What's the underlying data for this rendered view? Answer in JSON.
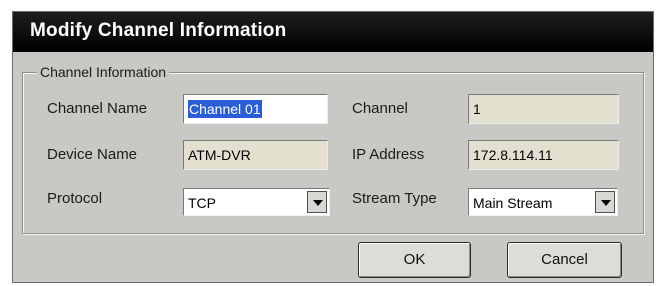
{
  "dialog": {
    "title": "Modify Channel Information"
  },
  "group": {
    "legend": "Channel Information"
  },
  "fields": {
    "channel_name": {
      "label": "Channel Name",
      "value": "Channel 01"
    },
    "channel": {
      "label": "Channel",
      "value": "1"
    },
    "device_name": {
      "label": "Device Name",
      "value": "ATM-DVR"
    },
    "ip_address": {
      "label": "IP Address",
      "value": "172.8.114.11"
    },
    "protocol": {
      "label": "Protocol",
      "value": "TCP"
    },
    "stream_type": {
      "label": "Stream Type",
      "value": "Main Stream"
    }
  },
  "buttons": {
    "ok": "OK",
    "cancel": "Cancel"
  },
  "colors": {
    "titlebar": "#000000",
    "dialog_bg": "#c8c8c4",
    "readonly_field": "#e4e0d0",
    "selection": "#2a5ed8"
  },
  "icons": {
    "dropdown": "chevron-down-icon"
  }
}
